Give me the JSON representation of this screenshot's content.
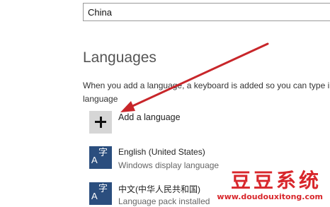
{
  "region": {
    "selected": "China"
  },
  "languages": {
    "title": "Languages",
    "description": "When you add a language, a keyboard is added so you can type in\nlanguage",
    "add_label": "Add a language",
    "items": [
      {
        "name": "English (United States)",
        "status": "Windows display language",
        "tile_letter": "A",
        "tile_glyph": "字"
      },
      {
        "name": "中文(中华人民共和国)",
        "status": "Language pack installed",
        "tile_letter": "A",
        "tile_glyph": "字"
      }
    ]
  },
  "watermark": {
    "brand": "豆豆系统",
    "url": "www.doudouxitong.com"
  },
  "colors": {
    "tile_blue": "#2b4e7e",
    "add_tile_gray": "#d6d6d6",
    "arrow_red": "#c8262a",
    "watermark_red": "#d8262b"
  }
}
